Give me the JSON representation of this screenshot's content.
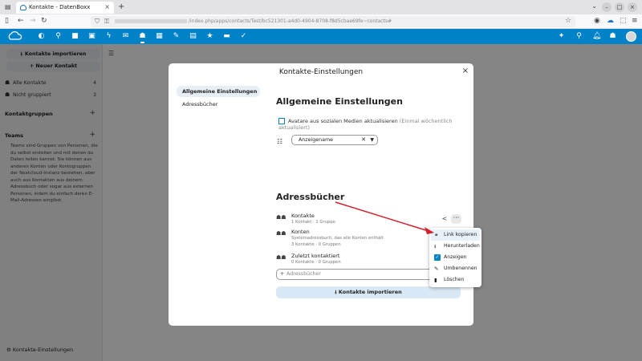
{
  "browser": {
    "tab_title": "Kontakte - DatenBoxx",
    "url": "/index.php/apps/contacts/Test/bc521301-a4d0-4904-8708-f8d5cbae69fe~contacts#"
  },
  "sidebar": {
    "import_label": "Kontakte importieren",
    "new_contact_label": "+ Neuer Kontakt",
    "items": [
      {
        "label": "Alle Kontakte",
        "count": "4"
      },
      {
        "label": "Nicht gruppiert",
        "count": "3"
      }
    ],
    "groups_label": "Kontaktgruppen",
    "teams_label": "Teams",
    "teams_desc": "Teams sind Gruppen von Personen, die du selbst erstellen und mit denen du Daten teilen kannst. Sie können aus anderen Konten oder Kontogruppen der Nextcloud-Instanz bestehen, aber auch aus Kontakten aus deinem Adressbuch oder sogar aus externen Personen, indem du einfach deren E-Mail-Adressen eingibst.",
    "footer_label": "Kontakte-Einstellungen"
  },
  "modal": {
    "title": "Kontakte-Einstellungen",
    "nav": [
      "Allgemeine Einstellungen",
      "Adressbücher"
    ],
    "general_title": "Allgemeine Einstellungen",
    "avatar_option": "Avatare aus sozialen Medien aktualisieren",
    "avatar_hint": "(Einmal wöchentlich aktualisiert)",
    "sort_value": "Anzeigename",
    "addressbooks_title": "Adressbücher",
    "addressbooks": [
      {
        "name": "Kontakte",
        "meta": "1 Kontakt · 1 Gruppe",
        "meta2": ""
      },
      {
        "name": "Konten",
        "meta": "Systemadressbuch, das alle Konten enthält",
        "meta2": "3 Kontakte · 0 Gruppen"
      },
      {
        "name": "Zuletzt kontaktiert",
        "meta": "0 Kontakte · 0 Gruppen",
        "meta2": ""
      }
    ],
    "add_placeholder": "Adressbücher",
    "import_label": "Kontakte importieren"
  },
  "popup": {
    "items": [
      {
        "label": "Link kopieren",
        "icon": "link-icon"
      },
      {
        "label": "Herunterladen",
        "icon": "download-icon"
      },
      {
        "label": "Anzeigen",
        "icon": "checkbox-icon"
      },
      {
        "label": "Umbenennen",
        "icon": "pencil-icon"
      },
      {
        "label": "Löschen",
        "icon": "trash-icon"
      }
    ]
  },
  "colors": {
    "brand": "#0082c9",
    "annotation": "#d4202a"
  }
}
